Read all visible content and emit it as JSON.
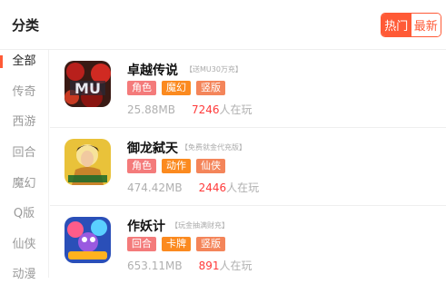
{
  "header": {
    "title": "分类",
    "toggle": {
      "hot_label": "热门",
      "new_label": "最新"
    }
  },
  "sidebar": {
    "items": [
      {
        "label": "全部",
        "active": true
      },
      {
        "label": "传奇"
      },
      {
        "label": "西游"
      },
      {
        "label": "回合"
      },
      {
        "label": "魔幻"
      },
      {
        "label": "Q版"
      },
      {
        "label": "仙侠"
      },
      {
        "label": "动漫"
      }
    ]
  },
  "games": [
    {
      "name": "卓越传说",
      "desc": "【送MU30万充】",
      "tags": [
        {
          "label": "角色",
          "color": "#f47b7b"
        },
        {
          "label": "魔幻",
          "color": "#fb8a1f"
        },
        {
          "label": "竖版",
          "color": "#f4855a"
        }
      ],
      "size": "25.88MB",
      "players": "7246",
      "players_suffix": "人在玩",
      "icon": "mu-game-icon"
    },
    {
      "name": "御龙弑天",
      "desc": "【免费就金代充版】",
      "tags": [
        {
          "label": "角色",
          "color": "#f47b7b"
        },
        {
          "label": "动作",
          "color": "#fb8a1f"
        },
        {
          "label": "仙侠",
          "color": "#f4855a"
        }
      ],
      "size": "474.42MB",
      "players": "2446",
      "players_suffix": "人在玩",
      "icon": "warrior-game-icon"
    },
    {
      "name": "作妖计",
      "desc": "【玩金抽满财充】",
      "tags": [
        {
          "label": "回合",
          "color": "#f47b7b"
        },
        {
          "label": "卡牌",
          "color": "#fb8a1f"
        },
        {
          "label": "竖版",
          "color": "#f4855a"
        }
      ],
      "size": "653.11MB",
      "players": "891",
      "players_suffix": "人在玩",
      "icon": "monster-game-icon"
    }
  ],
  "colors": {
    "accent": "#ff5a36",
    "players": "#ff3b3b"
  }
}
